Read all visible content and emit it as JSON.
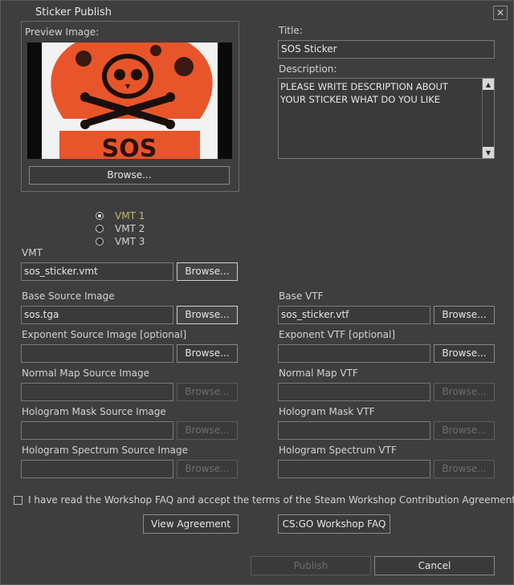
{
  "window": {
    "title": "Sticker Publish"
  },
  "preview": {
    "label": "Preview Image:",
    "browse_label": "Browse...",
    "image_text": "SOS"
  },
  "title_field": {
    "label": "Title:",
    "value": "SOS Sticker"
  },
  "description": {
    "label": "Description:",
    "value": "PLEASE WRITE DESCRIPTION ABOUT YOUR STICKER WHAT DO YOU LIKE"
  },
  "vmt_options": [
    "VMT 1",
    "VMT 2",
    "VMT 3"
  ],
  "vmt_selected": "VMT 1",
  "vmt": {
    "label": "VMT",
    "value": "sos_sticker.vmt",
    "browse_label": "Browse..."
  },
  "left_fields": [
    {
      "label": "Base Source Image",
      "value": "sos.tga",
      "browse_label": "Browse..."
    },
    {
      "label": "Exponent Source Image [optional]",
      "value": "",
      "browse_label": "Browse..."
    },
    {
      "label": "Normal Map Source Image",
      "value": "",
      "browse_label": "Browse..."
    },
    {
      "label": "Hologram Mask Source Image",
      "value": "",
      "browse_label": "Browse..."
    },
    {
      "label": "Hologram Spectrum Source Image",
      "value": "",
      "browse_label": "Browse..."
    }
  ],
  "right_fields": [
    {
      "label": "Base VTF",
      "value": "sos_sticker.vtf",
      "browse_label": "Browse..."
    },
    {
      "label": "Exponent VTF [optional]",
      "value": "",
      "browse_label": "Browse..."
    },
    {
      "label": "Normal Map VTF",
      "value": "",
      "browse_label": "Browse..."
    },
    {
      "label": "Hologram Mask VTF",
      "value": "",
      "browse_label": "Browse..."
    },
    {
      "label": "Hologram Spectrum VTF",
      "value": "",
      "browse_label": "Browse..."
    }
  ],
  "agreement": {
    "checkbox_label": "I have read the Workshop FAQ and accept the terms of the Steam Workshop Contribution Agreement",
    "view_agreement_label": "View Agreement",
    "faq_label": "CS:GO Workshop FAQ"
  },
  "footer": {
    "publish_label": "Publish",
    "cancel_label": "Cancel"
  },
  "colors": {
    "accent_selected": "#c8b86a",
    "background": "#3e3e3e",
    "disabled_text": "#6e6e6e"
  }
}
